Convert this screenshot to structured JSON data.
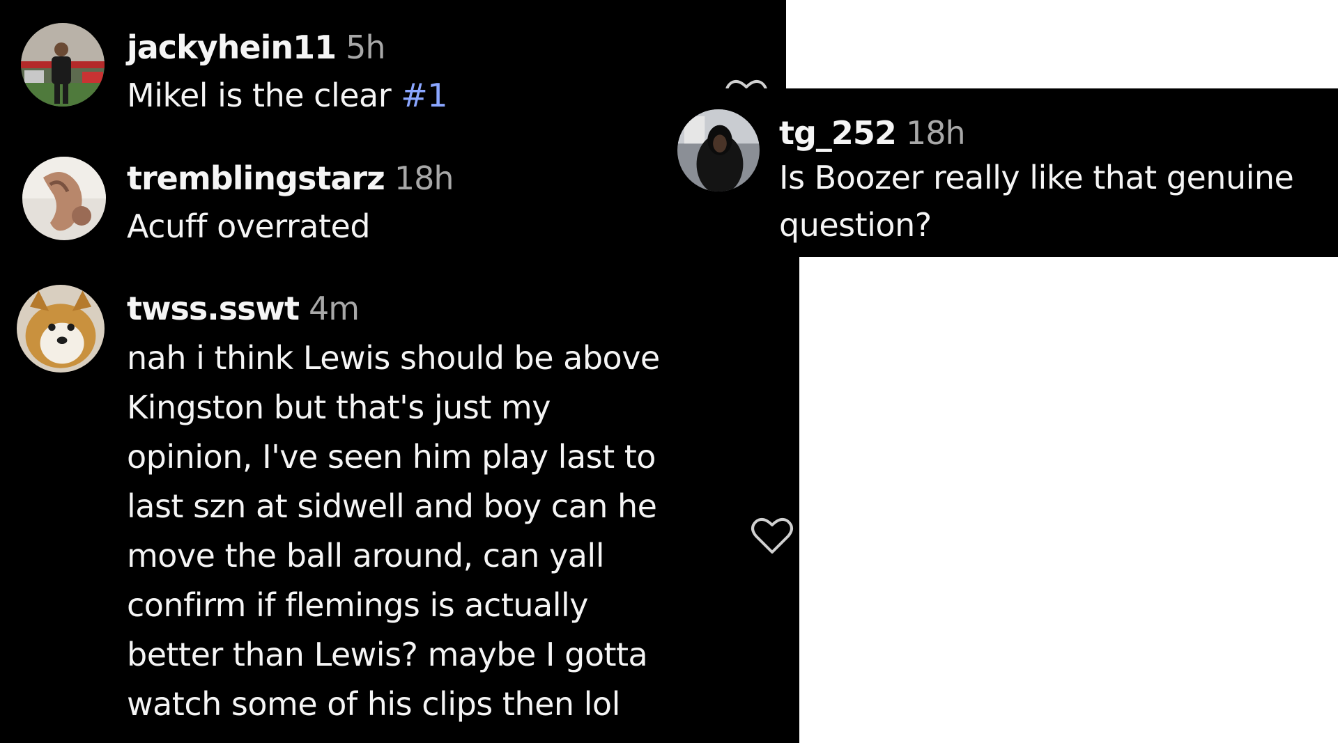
{
  "comments": [
    {
      "username": "jackyhein11",
      "time": "5h",
      "text_before_tag": "Mikel is the clear ",
      "tag": "#1",
      "avatar_icon": "avatar-man-football-field"
    },
    {
      "username": "tremblingstarz",
      "time": "18h",
      "text": "Acuff overrated",
      "avatar_icon": "avatar-hand-photo"
    },
    {
      "username": "tg_252",
      "time": "18h",
      "text_line1": "Is Boozer really like that genuine",
      "text_line2": "question?",
      "avatar_icon": "avatar-person-hoodie"
    },
    {
      "username": "twss.sswt",
      "time": "4m",
      "lines": [
        "nah i think Lewis should be above",
        "Kingston but that's just my",
        "opinion, I've seen him play last to",
        "last szn at sidwell and boy can he",
        "move the ball around, can yall",
        "confirm if flemings is actually",
        "better than Lewis? maybe I gotta",
        "watch some of his clips then lol"
      ],
      "avatar_icon": "avatar-shiba-dog"
    }
  ],
  "icons": {
    "like": "heart-outline-icon"
  },
  "colors": {
    "background": "#000000",
    "text": "#f5f5f5",
    "muted": "#a8a8a8",
    "hashtag": "#8aa6ff"
  }
}
